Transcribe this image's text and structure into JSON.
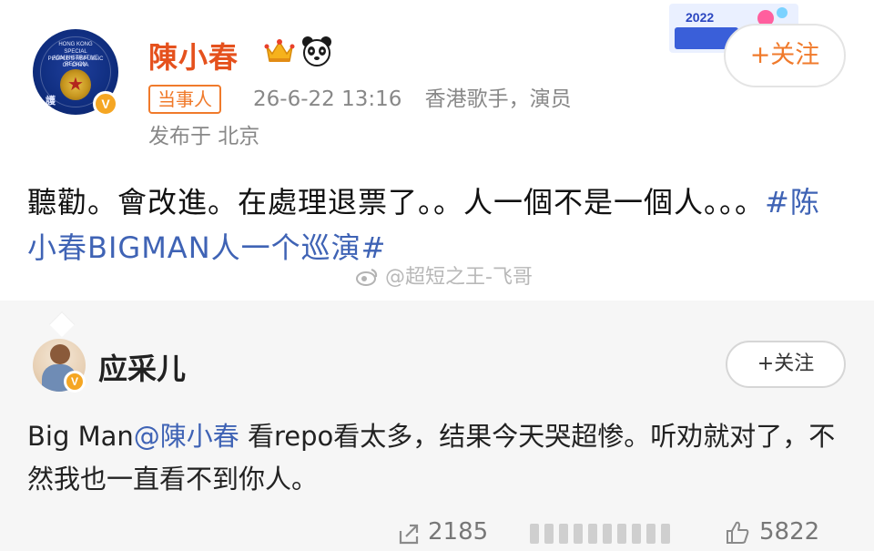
{
  "post": {
    "username": "陳小春",
    "role_badge": "当事人",
    "timestamp": "26-6-22 13:16",
    "bio": "香港歌手，演员",
    "location": "发布于 北京",
    "follow_label": "+关注",
    "text_main": "聽勸。會改進。在處理退票了。。人一個不是一個人。。。",
    "hashtag": "#陈小春BIGMAN人一个巡演#",
    "watermark": "@超短之王-飞哥",
    "banner_text": "2022",
    "avatar_text": {
      "line1": "HONG KONG",
      "line2": "SPECIAL ADMINISTRATIVE REGION",
      "line3": "PEOPLE'S REPUBLIC OF CHINA",
      "chop": "護"
    },
    "verify_mark": "V"
  },
  "comment": {
    "username": "应采儿",
    "follow_label": "+关注",
    "text_prefix": "Big Man",
    "mention": "@陳小春",
    "text_rest": " 看repo看太多，结果今天哭超惨。听劝就对了，不然我也一直看不到你人。",
    "verify_mark": "V"
  },
  "stats": {
    "shares": "2185",
    "likes": "5822"
  },
  "colors": {
    "username_orange": "#e5511d",
    "badge_orange": "#f07a2b",
    "link_blue": "#3f63b5",
    "meta_gray": "#888888",
    "comment_bg": "#f6f6f6",
    "verify_gold": "#f5a623"
  },
  "icons": [
    "crown-icon",
    "panda-icon",
    "share-icon",
    "like-icon",
    "verified-icon"
  ]
}
